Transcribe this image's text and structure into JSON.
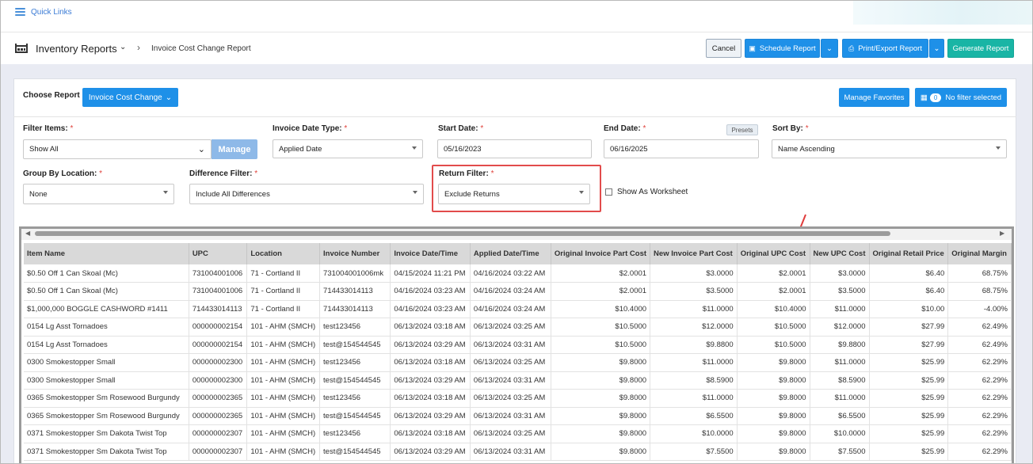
{
  "quick_links": {
    "label": "Quick Links"
  },
  "header": {
    "title": "Inventory Reports",
    "subtitle": "Invoice Cost Change Report",
    "cancel": "Cancel",
    "schedule": "Schedule Report",
    "print": "Print/Export Report",
    "generate": "Generate Report"
  },
  "report": {
    "choose_label": "Choose Report",
    "choose_value": "Invoice Cost Change",
    "manage_favorites": "Manage Favorites",
    "filter_count": "0",
    "no_filter": "No filter selected"
  },
  "filters": {
    "filter_items_label": "Filter Items:",
    "filter_items_value": "Show All",
    "manage": "Manage",
    "invoice_date_type_label": "Invoice Date Type:",
    "invoice_date_type_value": "Applied Date",
    "start_date_label": "Start Date:",
    "start_date_value": "05/16/2023",
    "end_date_label": "End Date:",
    "end_date_value": "06/16/2025",
    "presets": "Presets",
    "sort_by_label": "Sort By:",
    "sort_by_value": "Name Ascending",
    "group_by_label": "Group By Location:",
    "group_by_value": "None",
    "difference_label": "Difference Filter:",
    "difference_value": "Include All Differences",
    "return_label": "Return Filter:",
    "return_value": "Exclude Returns",
    "worksheet_label": "Show As Worksheet",
    "required_mark": "*"
  },
  "table": {
    "columns": [
      "Item Name",
      "UPC",
      "Location",
      "Invoice Number",
      "Invoice Date/Time",
      "Applied Date/Time",
      "Original Invoice Part Cost",
      "New Invoice Part Cost",
      "Original UPC Cost",
      "New UPC Cost",
      "Original Retail Price",
      "Original Margin"
    ],
    "rows": [
      [
        "$0.50 Off 1 Can Skoal (Mc)",
        "731004001006",
        "71 - Cortland II",
        "731004001006mk",
        "04/15/2024 11:21 PM",
        "04/16/2024 03:22 AM",
        "$2.0001",
        "$3.0000",
        "$2.0001",
        "$3.0000",
        "$6.40",
        "68.75%"
      ],
      [
        "$0.50 Off 1 Can Skoal (Mc)",
        "731004001006",
        "71 - Cortland II",
        "714433014113",
        "04/16/2024 03:23 AM",
        "04/16/2024 03:24 AM",
        "$2.0001",
        "$3.5000",
        "$2.0001",
        "$3.5000",
        "$6.40",
        "68.75%"
      ],
      [
        "$1,000,000 BOGGLE CASHWORD #1411",
        "714433014113",
        "71 - Cortland II",
        "714433014113",
        "04/16/2024 03:23 AM",
        "04/16/2024 03:24 AM",
        "$10.4000",
        "$11.0000",
        "$10.4000",
        "$11.0000",
        "$10.00",
        "-4.00%"
      ],
      [
        "0154 Lg Asst Tornadoes",
        "000000002154",
        "101 - AHM (SMCH)",
        "test123456",
        "06/13/2024 03:18 AM",
        "06/13/2024 03:25 AM",
        "$10.5000",
        "$12.0000",
        "$10.5000",
        "$12.0000",
        "$27.99",
        "62.49%"
      ],
      [
        "0154 Lg Asst Tornadoes",
        "000000002154",
        "101 - AHM (SMCH)",
        "test@154544545",
        "06/13/2024 03:29 AM",
        "06/13/2024 03:31 AM",
        "$10.5000",
        "$9.8800",
        "$10.5000",
        "$9.8800",
        "$27.99",
        "62.49%"
      ],
      [
        "0300 Smokestopper Small",
        "000000002300",
        "101 - AHM (SMCH)",
        "test123456",
        "06/13/2024 03:18 AM",
        "06/13/2024 03:25 AM",
        "$9.8000",
        "$11.0000",
        "$9.8000",
        "$11.0000",
        "$25.99",
        "62.29%"
      ],
      [
        "0300 Smokestopper Small",
        "000000002300",
        "101 - AHM (SMCH)",
        "test@154544545",
        "06/13/2024 03:29 AM",
        "06/13/2024 03:31 AM",
        "$9.8000",
        "$8.5900",
        "$9.8000",
        "$8.5900",
        "$25.99",
        "62.29%"
      ],
      [
        "0365 Smokestopper Sm Rosewood Burgundy",
        "000000002365",
        "101 - AHM (SMCH)",
        "test123456",
        "06/13/2024 03:18 AM",
        "06/13/2024 03:25 AM",
        "$9.8000",
        "$11.0000",
        "$9.8000",
        "$11.0000",
        "$25.99",
        "62.29%"
      ],
      [
        "0365 Smokestopper Sm Rosewood Burgundy",
        "000000002365",
        "101 - AHM (SMCH)",
        "test@154544545",
        "06/13/2024 03:29 AM",
        "06/13/2024 03:31 AM",
        "$9.8000",
        "$6.5500",
        "$9.8000",
        "$6.5500",
        "$25.99",
        "62.29%"
      ],
      [
        "0371 Smokestopper Sm Dakota Twist Top",
        "000000002307",
        "101 - AHM (SMCH)",
        "test123456",
        "06/13/2024 03:18 AM",
        "06/13/2024 03:25 AM",
        "$9.8000",
        "$10.0000",
        "$9.8000",
        "$10.0000",
        "$25.99",
        "62.29%"
      ],
      [
        "0371 Smokestopper Sm Dakota Twist Top",
        "000000002307",
        "101 - AHM (SMCH)",
        "test@154544545",
        "06/13/2024 03:29 AM",
        "06/13/2024 03:31 AM",
        "$9.8000",
        "$7.5500",
        "$9.8000",
        "$7.5500",
        "$25.99",
        "62.29%"
      ]
    ]
  },
  "colors": {
    "accent": "#1e90e8",
    "generate": "#19b5a5",
    "highlight": "#e24b4b"
  },
  "icons": [
    "menu-icon",
    "warehouse-icon",
    "chevron-down-icon",
    "chevron-right-icon",
    "calendar-icon",
    "printer-icon",
    "filter-grid-icon",
    "caret-down-icon",
    "red-arrow-annotation"
  ]
}
